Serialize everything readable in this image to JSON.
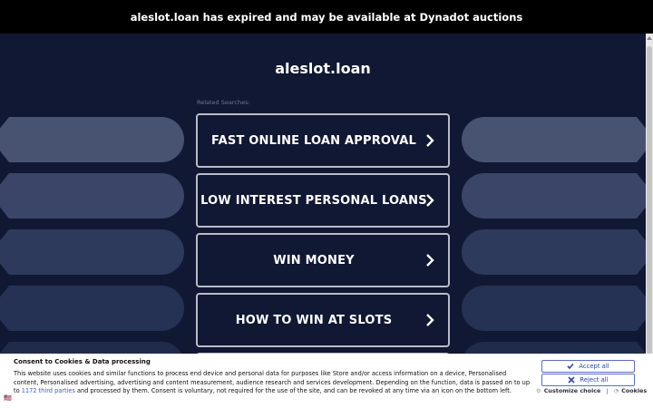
{
  "banner": {
    "text": "aleslot.loan has expired and may be available at Dynadot auctions"
  },
  "site": {
    "title": "aleslot.loan"
  },
  "related": {
    "label": "Related Searches:"
  },
  "links": [
    {
      "label": "FAST ONLINE LOAN APPROVAL"
    },
    {
      "label": "LOW INTEREST PERSONAL LOANS"
    },
    {
      "label": "WIN MONEY"
    },
    {
      "label": "HOW TO WIN AT SLOTS"
    }
  ],
  "consent": {
    "title": "Consent to Cookies & Data processing",
    "text_part1": "This website uses cookies and similar functions to process end device and personal data for purposes like Store and/or access information on a device, Personalised content, Personalised advertising, advertising and content measurement, audience research and services development. Depending on the function, data is passed on to up to ",
    "third_parties_link": "1172 third parties",
    "text_part2": " and processed by them. Consent is voluntary, not required for the use of the site, and can be revoked at any time via an icon on the bottom left.",
    "accept_label": "Accept all",
    "reject_label": "Reject all",
    "customize_label": "Customize choice",
    "separator": "|",
    "cookies_label": "Cookies",
    "flag": "🇺🇸"
  },
  "colors": {
    "background": "#111833",
    "shape_top": "#3d4766",
    "shape_bottom": "#1e2a4a",
    "button_border": "#b9bcc7",
    "consent_button": "#2a46b8"
  }
}
